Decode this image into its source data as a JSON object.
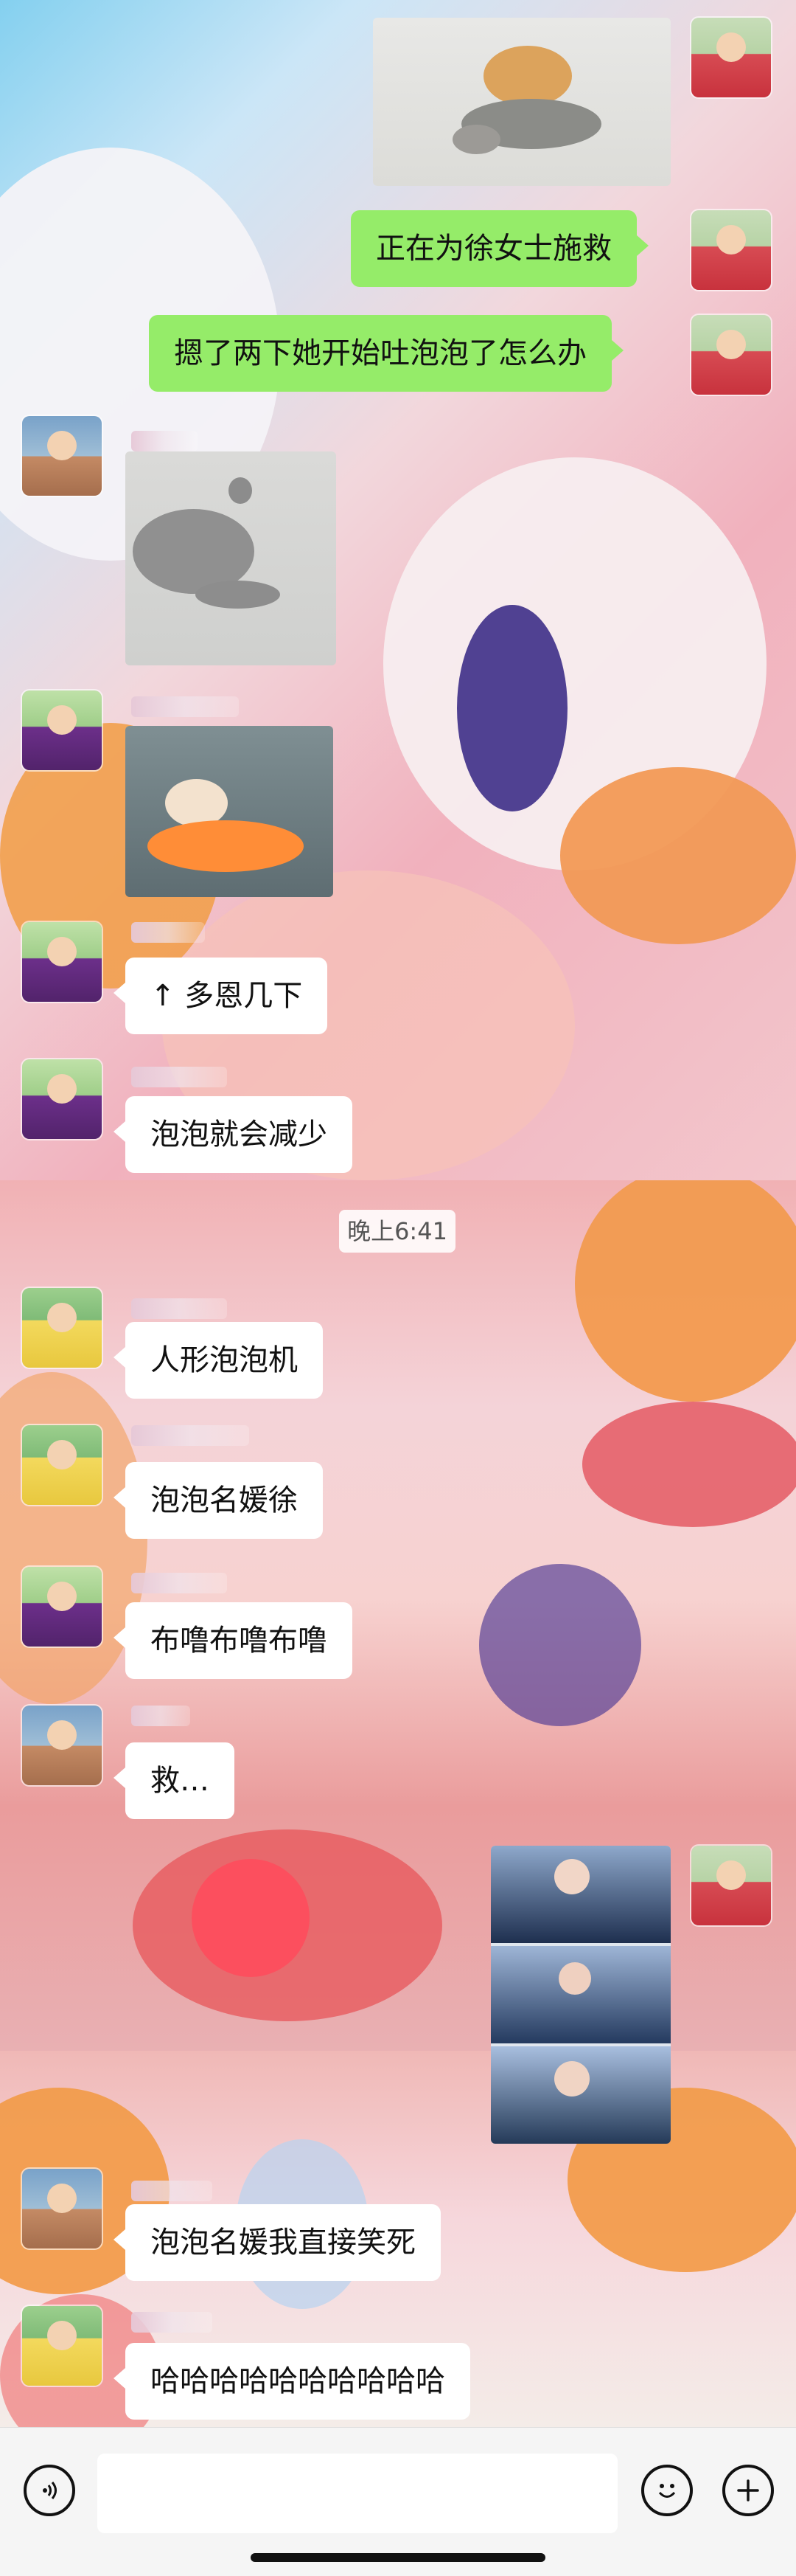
{
  "messages": [
    {
      "side": "right",
      "avatar": "red-teletubby-avatar",
      "type": "image",
      "image": "cat-pressing-cat-photo"
    },
    {
      "side": "right",
      "avatar": "red-teletubby-avatar",
      "type": "text",
      "text": "正在为徐女士施救"
    },
    {
      "side": "right",
      "avatar": "red-teletubby-avatar",
      "type": "text",
      "text": "摁了两下她开始吐泡泡了怎么办"
    },
    {
      "side": "left",
      "avatar": "family-photo-avatar",
      "type": "image",
      "image": "cat-lying-on-floor-photo"
    },
    {
      "side": "left",
      "avatar": "purple-teletubby-avatar",
      "type": "image",
      "image": "cat-on-orange-blanket-photo"
    },
    {
      "side": "left",
      "avatar": "purple-teletubby-avatar",
      "type": "text",
      "text": "↑ 多恩几下"
    },
    {
      "side": "left",
      "avatar": "purple-teletubby-avatar",
      "type": "text",
      "text": "泡泡就会减少"
    },
    {
      "side": "left",
      "avatar": "yellow-teletubby-avatar",
      "type": "text",
      "text": "人形泡泡机"
    },
    {
      "side": "left",
      "avatar": "yellow-teletubby-avatar",
      "type": "text",
      "text": "泡泡名媛徐"
    },
    {
      "side": "left",
      "avatar": "purple-teletubby-avatar",
      "type": "text",
      "text": "布噜布噜布噜"
    },
    {
      "side": "left",
      "avatar": "family-photo-avatar",
      "type": "text",
      "text": "救…"
    },
    {
      "side": "right",
      "avatar": "red-teletubby-avatar",
      "type": "image",
      "image": "drama-stills-collage"
    },
    {
      "side": "left",
      "avatar": "family-photo-avatar",
      "type": "text",
      "text": "泡泡名媛我直接笑死"
    },
    {
      "side": "left",
      "avatar": "yellow-teletubby-avatar",
      "type": "text",
      "text": "哈哈哈哈哈哈哈哈哈哈"
    }
  ],
  "timestamp": "晚上6:41",
  "composer": {
    "voice_icon": "voice-icon",
    "emoji_icon": "emoji-icon",
    "plus_icon": "plus-icon",
    "input_value": ""
  },
  "colors": {
    "sent_bubble": "#95ec69",
    "received_bubble": "#ffffff",
    "bottom_bar": "#f5f5f5"
  }
}
